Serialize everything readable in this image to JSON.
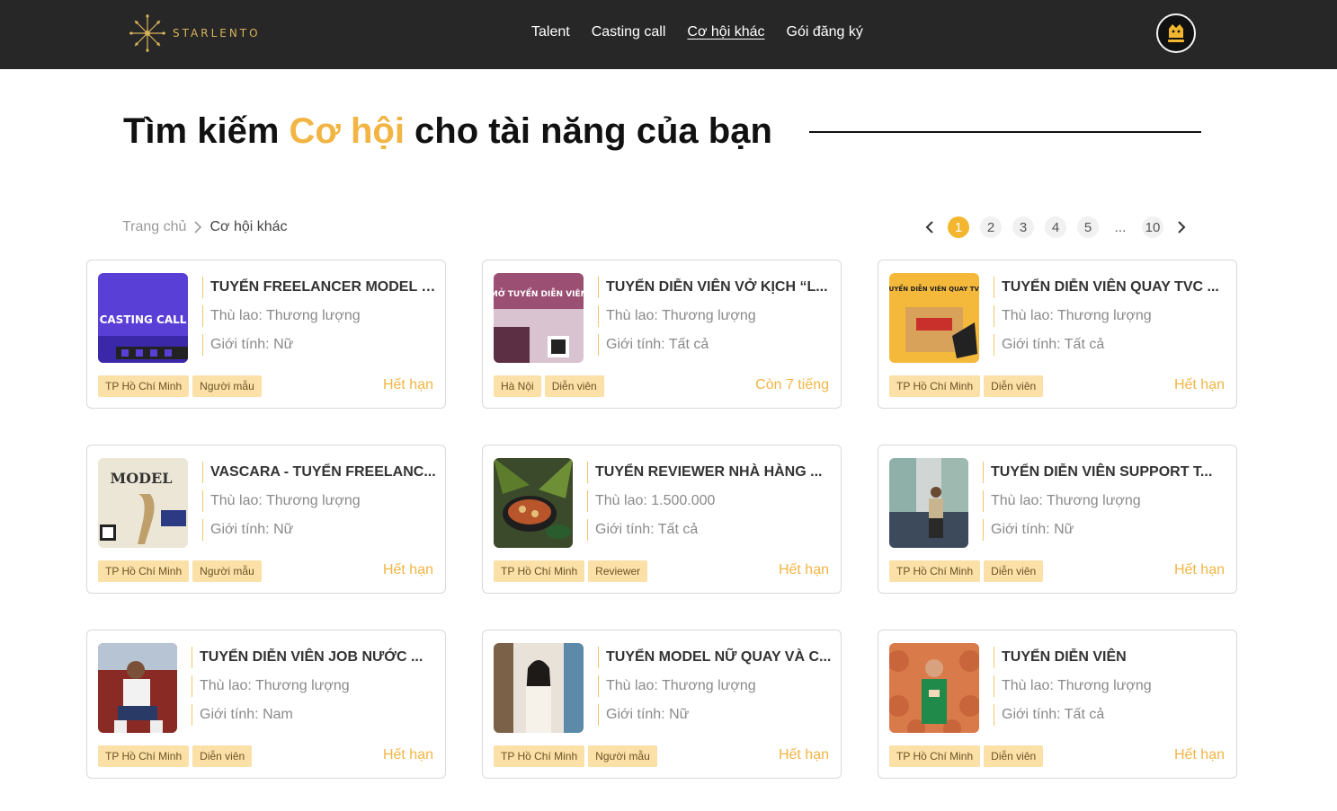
{
  "header": {
    "logo_text": "STARLENTO",
    "nav": [
      "Talent",
      "Casting call",
      "Cơ hội khác",
      "Gói đăng ký"
    ],
    "active_nav": 2
  },
  "title": {
    "before": "Tìm kiếm ",
    "highlight": "Cơ hội",
    "after": " cho tài năng của bạn"
  },
  "breadcrumb": {
    "home": "Trang chủ",
    "current": "Cơ hội khác"
  },
  "pagination": {
    "pages": [
      "1",
      "2",
      "3",
      "4",
      "5"
    ],
    "ellipsis": "...",
    "last": "10",
    "current": 1
  },
  "colors": {
    "header_bg": "#272727",
    "accent": "#f2b544",
    "tag_bg": "#fbe0a8",
    "page_active": "#f2b72f"
  },
  "cards": [
    {
      "title": "TUYỂN FREELANCER MODEL F...",
      "pay": "Thù lao: Thương lượng",
      "gender": "Giới tính: Nữ",
      "tags": [
        "TP Hồ Chí Minh",
        "Người mẫu"
      ],
      "status": "Hết hạn",
      "thumb_text": "CASTING CALL"
    },
    {
      "title": "TUYỂN DIỄN VIÊN VỞ KỊCH “L...",
      "pay": "Thù lao: Thương lượng",
      "gender": "Giới tính: Tất cả",
      "tags": [
        "Hà Nội",
        "Diễn viên"
      ],
      "status": "Còn 7 tiếng",
      "thumb_text": "MỞ TUYỂN DIỄN VIÊN"
    },
    {
      "title": "TUYỂN DIỄN VIÊN QUAY TVC ...",
      "pay": "Thù lao: Thương lượng",
      "gender": "Giới tính: Tất cả",
      "tags": [
        "TP Hồ Chí Minh",
        "Diễn viên"
      ],
      "status": "Hết hạn",
      "thumb_text": "TUYỂN DIỄN VIÊN QUAY TVC"
    },
    {
      "title": "VASCARA - TUYỂN FREELANC...",
      "pay": "Thù lao: Thương lượng",
      "gender": "Giới tính: Nữ",
      "tags": [
        "TP Hồ Chí Minh",
        "Người mẫu"
      ],
      "status": "Hết hạn",
      "thumb_text": "MODEL"
    },
    {
      "title": "TUYỂN REVIEWER NHÀ HÀNG ...",
      "pay": "Thù lao: 1.500.000",
      "gender": "Giới tính: Tất cả",
      "tags": [
        "TP Hồ Chí Minh",
        "Reviewer"
      ],
      "status": "Hết hạn",
      "thumb_text": ""
    },
    {
      "title": "TUYỂN DIỄN VIÊN SUPPORT T...",
      "pay": "Thù lao: Thương lượng",
      "gender": "Giới tính: Nữ",
      "tags": [
        "TP Hồ Chí Minh",
        "Diễn viên"
      ],
      "status": "Hết hạn",
      "thumb_text": ""
    },
    {
      "title": "TUYỂN DIỄN VIÊN JOB NƯỚC ...",
      "pay": "Thù lao: Thương lượng",
      "gender": "Giới tính: Nam",
      "tags": [
        "TP Hồ Chí Minh",
        "Diễn viên"
      ],
      "status": "Hết hạn",
      "thumb_text": ""
    },
    {
      "title": "TUYỂN MODEL NỮ QUAY VÀ C...",
      "pay": "Thù lao: Thương lượng",
      "gender": "Giới tính: Nữ",
      "tags": [
        "TP Hồ Chí Minh",
        "Người mẫu"
      ],
      "status": "Hết hạn",
      "thumb_text": ""
    },
    {
      "title": "TUYỂN DIỄN VIÊN",
      "pay": "Thù lao: Thương lượng",
      "gender": "Giới tính: Tất cả",
      "tags": [
        "TP Hồ Chí Minh",
        "Diễn viên"
      ],
      "status": "Hết hạn",
      "thumb_text": ""
    }
  ]
}
